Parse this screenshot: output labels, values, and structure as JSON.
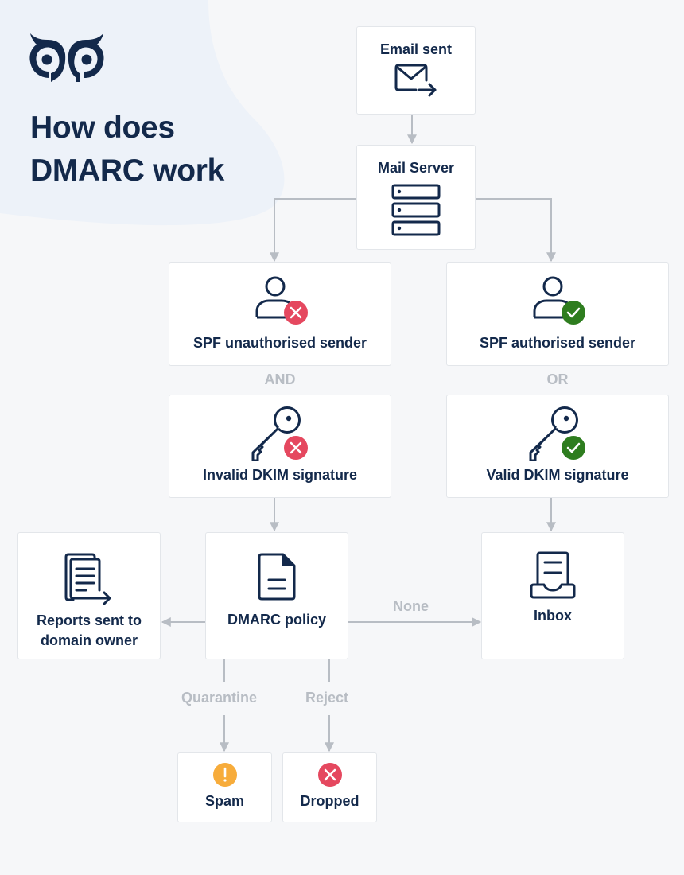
{
  "header": {
    "logo_icon": "owl-eyes-logo-icon",
    "title_line1": "How does",
    "title_line2": "DMARC work"
  },
  "colors": {
    "navy": "#13294b",
    "error_red": "#e5485f",
    "success_green": "#2e7d1f",
    "warning_amber": "#f7ac3b",
    "connector_gray": "#b8bdc4",
    "background": "#f6f7f9",
    "blob": "#edf2f9"
  },
  "nodes": {
    "email_sent": {
      "label": "Email sent",
      "icon": "envelope-send-icon"
    },
    "mail_server": {
      "label": "Mail Server",
      "icon": "server-stack-icon"
    },
    "spf_fail": {
      "label": "SPF unauthorised sender",
      "icon": "user-icon",
      "status": "fail"
    },
    "spf_pass": {
      "label": "SPF authorised sender",
      "icon": "user-icon",
      "status": "pass"
    },
    "dkim_fail": {
      "label": "Invalid DKIM signature",
      "icon": "key-icon",
      "status": "fail"
    },
    "dkim_pass": {
      "label": "Valid DKIM signature",
      "icon": "key-icon",
      "status": "pass"
    },
    "reports": {
      "label_line1": "Reports sent to",
      "label_line2": "domain owner",
      "icon": "documents-send-icon"
    },
    "dmarc_policy": {
      "label": "DMARC policy",
      "icon": "document-icon"
    },
    "inbox": {
      "label": "Inbox",
      "icon": "inbox-tray-icon"
    },
    "spam": {
      "label": "Spam",
      "icon": "warning-icon"
    },
    "dropped": {
      "label": "Dropped",
      "icon": "error-icon"
    }
  },
  "conjunctions": {
    "left": "AND",
    "right": "OR"
  },
  "edge_labels": {
    "none": "None",
    "quarantine": "Quarantine",
    "reject": "Reject"
  }
}
